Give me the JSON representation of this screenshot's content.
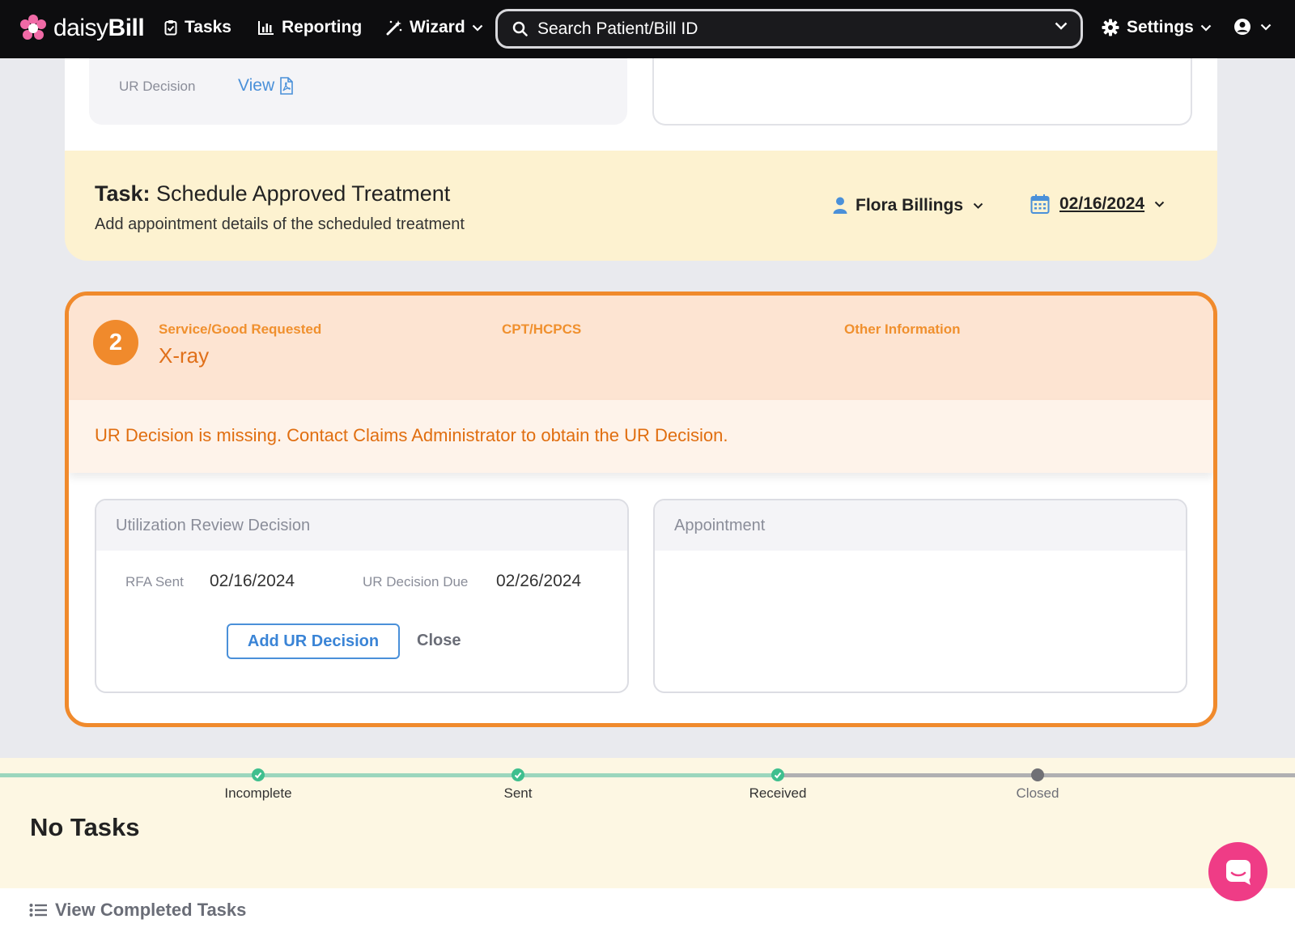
{
  "nav": {
    "logo_light": "daisy",
    "logo_bold": "Bill",
    "tasks_label": "Tasks",
    "reporting_label": "Reporting",
    "wizard_label": "Wizard",
    "search_placeholder": "Search Patient/Bill ID",
    "settings_label": "Settings"
  },
  "previous_item": {
    "ur_decision_label": "UR Decision",
    "view_link": "View"
  },
  "task": {
    "prefix": "Task:",
    "title": "Schedule Approved Treatment",
    "subtitle": "Add appointment details of the scheduled treatment",
    "assignee": "Flora Billings",
    "due_date": "02/16/2024"
  },
  "item": {
    "number": "2",
    "service_label": "Service/Good Requested",
    "service_value": "X-ray",
    "cpt_label": "CPT/HCPCS",
    "other_label": "Other Information",
    "alert": "UR Decision is missing. Contact Claims Administrator to obtain the UR Decision.",
    "ur_card": {
      "title": "Utilization Review Decision",
      "rfa_sent_label": "RFA Sent",
      "rfa_sent_value": "02/16/2024",
      "due_label": "UR Decision Due",
      "due_value": "02/26/2024",
      "add_button": "Add UR Decision",
      "close_button": "Close"
    },
    "appointment_card": {
      "title": "Appointment"
    }
  },
  "progress": {
    "completed_fraction": 0.6,
    "steps": [
      {
        "label": "Incomplete",
        "status": "done"
      },
      {
        "label": "Sent",
        "status": "done"
      },
      {
        "label": "Received",
        "status": "done"
      },
      {
        "label": "Closed",
        "status": "pending"
      }
    ]
  },
  "tasks_section": {
    "empty_label": "No Tasks",
    "view_completed": "View Completed Tasks"
  },
  "colors": {
    "accent_orange": "#f08a2c",
    "link_blue": "#4a90d9",
    "banner_yellow": "#fdf2d0",
    "success_green": "#3fbf8e",
    "chat_pink": "#ef3c86"
  },
  "icons": [
    "daisy-logo-icon",
    "clipboard-check-icon",
    "bar-chart-icon",
    "magic-wand-icon",
    "search-icon",
    "chevron-down-icon",
    "gear-icon",
    "user-circle-icon",
    "pdf-file-icon",
    "person-icon",
    "calendar-icon",
    "check-icon",
    "list-icon",
    "chat-icon"
  ]
}
